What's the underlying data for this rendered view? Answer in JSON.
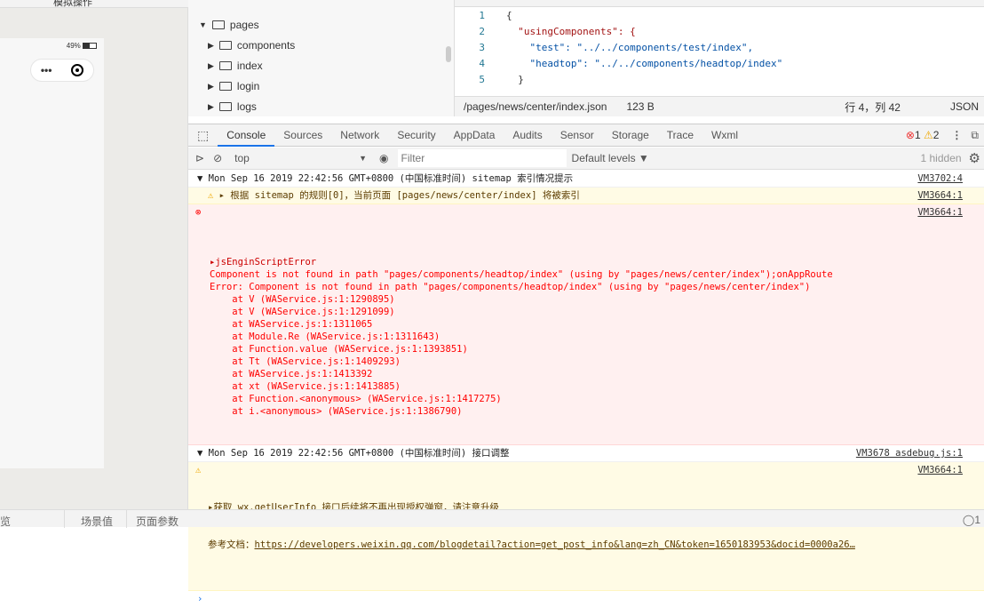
{
  "simulator": {
    "battery": "49%",
    "toolbar_label": "模拟操作"
  },
  "tree": {
    "items": [
      {
        "label": "pages",
        "expanded": true
      },
      {
        "label": "components"
      },
      {
        "label": "index"
      },
      {
        "label": "login"
      },
      {
        "label": "logs"
      }
    ]
  },
  "editor": {
    "lines": [
      {
        "n": "1",
        "t": "{"
      },
      {
        "n": "2",
        "t": "  \"usingComponents\": {"
      },
      {
        "n": "3",
        "t": "    \"test\": \"../../components/test/index\","
      },
      {
        "n": "4",
        "t": "    \"headtop\": \"../../components/headtop/index\""
      },
      {
        "n": "5",
        "t": "  }"
      }
    ]
  },
  "status": {
    "path": "/pages/news/center/index.json",
    "size": "123 B",
    "cursor": "行 4，列 42",
    "lang": "JSON"
  },
  "devtools": {
    "tabs": [
      "Console",
      "Sources",
      "Network",
      "Security",
      "AppData",
      "Audits",
      "Sensor",
      "Storage",
      "Trace",
      "Wxml"
    ],
    "active": "Console",
    "errors": "1",
    "warnings": "2"
  },
  "console_toolbar": {
    "context": "top",
    "filter_placeholder": "Filter",
    "levels": "Default levels ▼",
    "hidden": "1 hidden"
  },
  "console": {
    "group1": {
      "text": "▼ Mon Sep 16 2019 22:42:56 GMT+0800 (中国标准时间) sitemap 索引情况提示",
      "src": "VM3702:4"
    },
    "warn1": {
      "text": "▸ 根据 sitemap 的规则[0]，当前页面 [pages/news/center/index] 将被索引",
      "src": "VM3664:1"
    },
    "error": {
      "src": "VM3664:1",
      "lines": [
        "▸jsEnginScriptError",
        "Component is not found in path \"pages/components/headtop/index\" (using by \"pages/news/center/index\");onAppRoute",
        "Error: Component is not found in path \"pages/components/headtop/index\" (using by \"pages/news/center/index\")",
        "    at V (WAService.js:1:1290895)",
        "    at V (WAService.js:1:1291099)",
        "    at WAService.js:1:1311065",
        "    at Module.Re (WAService.js:1:1311643)",
        "    at Function.value (WAService.js:1:1393851)",
        "    at Tt (WAService.js:1:1409293)",
        "    at WAService.js:1:1413392",
        "    at xt (WAService.js:1:1413885)",
        "    at Function.<anonymous> (WAService.js:1:1417275)",
        "    at i.<anonymous> (WAService.js:1:1386790)"
      ]
    },
    "group2": {
      "text": "▼ Mon Sep 16 2019 22:42:56 GMT+0800 (中国标准时间) 接口调整",
      "src": "VM3678 asdebug.js:1"
    },
    "warn2": {
      "line1": "▸获取 wx.getUserInfo 接口后续将不再出现授权弹窗，请注意升级",
      "label": "参考文档：",
      "link": "https://developers.weixin.qq.com/blogdetail?action=get_post_info&lang=zh_CN&token=1650183953&docid=0000a26…",
      "src": "VM3664:1"
    },
    "prompt": "›"
  },
  "bottom": {
    "items": [
      "场景值",
      "页面参数"
    ],
    "left_partial": "览",
    "right": "1"
  }
}
